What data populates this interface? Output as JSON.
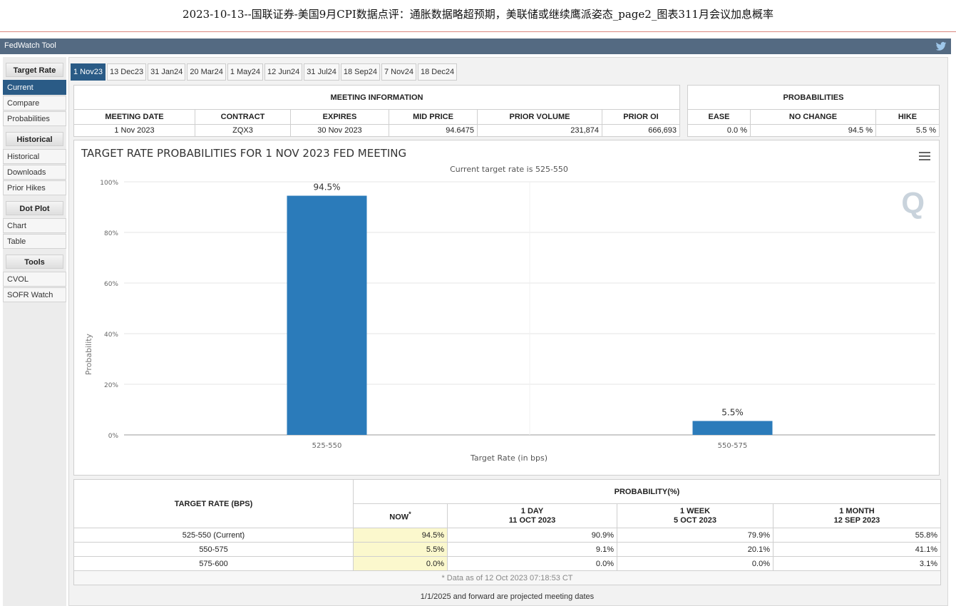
{
  "doc": {
    "title": "2023-10-13--国联证券-美国9月CPI数据点评：通胀数据略超预期，美联储或继续鹰派姿态_page2_图表311月会议加息概率"
  },
  "app": {
    "name": "FedWatch Tool",
    "twitter_icon": "twitter-icon"
  },
  "sidebar": {
    "sections": [
      {
        "title": "Target Rate",
        "items": [
          "Current",
          "Compare",
          "Probabilities"
        ]
      },
      {
        "title": "Historical",
        "items": [
          "Historical",
          "Downloads",
          "Prior Hikes"
        ]
      },
      {
        "title": "Dot Plot",
        "items": [
          "Chart",
          "Table"
        ]
      },
      {
        "title": "Tools",
        "items": [
          "CVOL",
          "SOFR Watch"
        ]
      }
    ],
    "active": "Current"
  },
  "tabs": [
    "1 Nov23",
    "13 Dec23",
    "31 Jan24",
    "20 Mar24",
    "1 May24",
    "12 Jun24",
    "31 Jul24",
    "18 Sep24",
    "7 Nov24",
    "18 Dec24"
  ],
  "meeting": {
    "section_title": "MEETING INFORMATION",
    "headers": [
      "MEETING DATE",
      "CONTRACT",
      "EXPIRES",
      "MID PRICE",
      "PRIOR VOLUME",
      "PRIOR OI"
    ],
    "values": [
      "1 Nov 2023",
      "ZQX3",
      "30 Nov 2023",
      "94.6475",
      "231,874",
      "666,693"
    ]
  },
  "probabilities": {
    "section_title": "PROBABILITIES",
    "headers": [
      "EASE",
      "NO CHANGE",
      "HIKE"
    ],
    "values": [
      "0.0 %",
      "94.5 %",
      "5.5 %"
    ]
  },
  "chart_data": {
    "type": "bar",
    "title": "TARGET RATE PROBABILITIES FOR 1 NOV 2023 FED MEETING",
    "subtitle": "Current target rate is 525-550",
    "xlabel": "Target Rate (in bps)",
    "ylabel": "Probability",
    "categories": [
      "525-550",
      "550-575"
    ],
    "values": [
      94.5,
      5.5
    ],
    "data_labels": [
      "94.5%",
      "5.5%"
    ],
    "yticks": [
      "0%",
      "20%",
      "40%",
      "60%",
      "80%",
      "100%"
    ],
    "ylim": [
      0,
      100
    ],
    "bar_color": "#2b7bba",
    "grid": true
  },
  "bottom": {
    "col1_header": "TARGET RATE (BPS)",
    "prob_header": "PROBABILITY(%)",
    "sub_headers": [
      {
        "line1": "NOW",
        "line2": ""
      },
      {
        "line1": "1 DAY",
        "line2": "11 OCT 2023"
      },
      {
        "line1": "1 WEEK",
        "line2": "5 OCT 2023"
      },
      {
        "line1": "1 MONTH",
        "line2": "12 SEP 2023"
      }
    ],
    "rows": [
      {
        "rate": "525-550 (Current)",
        "now": "94.5%",
        "d1": "90.9%",
        "w1": "79.9%",
        "m1": "55.8%"
      },
      {
        "rate": "550-575",
        "now": "5.5%",
        "d1": "9.1%",
        "w1": "20.1%",
        "m1": "41.1%"
      },
      {
        "rate": "575-600",
        "now": "0.0%",
        "d1": "0.0%",
        "w1": "0.0%",
        "m1": "3.1%"
      }
    ],
    "note": "* Data as of 12 Oct 2023 07:18:53 CT",
    "footer": "1/1/2025 and forward are projected meeting dates"
  }
}
